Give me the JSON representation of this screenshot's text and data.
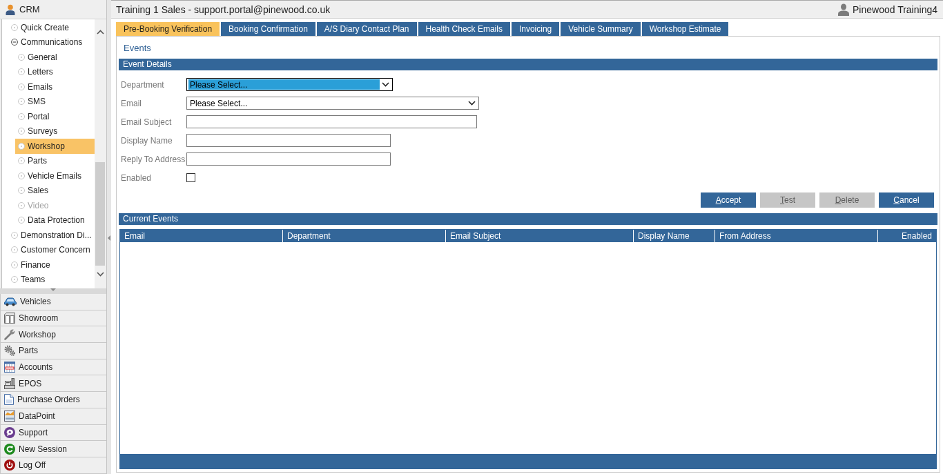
{
  "header": {
    "title": "Training 1 Sales - support.portal@pinewood.co.uk",
    "user": "Pinewood Training4"
  },
  "sidebar": {
    "title": "CRM",
    "tree": [
      {
        "label": "Quick Create",
        "selected": false,
        "disabled": false
      },
      {
        "label": "Communications",
        "selected": false,
        "disabled": false,
        "expanded": true,
        "children": [
          {
            "label": "General",
            "selected": false,
            "disabled": false
          },
          {
            "label": "Letters",
            "selected": false,
            "disabled": false
          },
          {
            "label": "Emails",
            "selected": false,
            "disabled": false
          },
          {
            "label": "SMS",
            "selected": false,
            "disabled": false
          },
          {
            "label": "Portal",
            "selected": false,
            "disabled": false
          },
          {
            "label": "Surveys",
            "selected": false,
            "disabled": false
          },
          {
            "label": "Workshop",
            "selected": true,
            "disabled": false
          },
          {
            "label": "Parts",
            "selected": false,
            "disabled": false
          },
          {
            "label": "Vehicle Emails",
            "selected": false,
            "disabled": false
          },
          {
            "label": "Sales",
            "selected": false,
            "disabled": false
          },
          {
            "label": "Video",
            "selected": false,
            "disabled": true
          },
          {
            "label": "Data Protection",
            "selected": false,
            "disabled": false
          }
        ]
      },
      {
        "label": "Demonstration Di...",
        "selected": false,
        "disabled": false
      },
      {
        "label": "Customer Concern",
        "selected": false,
        "disabled": false
      },
      {
        "label": "Finance",
        "selected": false,
        "disabled": false
      },
      {
        "label": "Teams",
        "selected": false,
        "disabled": false
      }
    ],
    "nav": [
      "Vehicles",
      "Showroom",
      "Workshop",
      "Parts",
      "Accounts",
      "EPOS",
      "Purchase Orders",
      "DataPoint",
      "Support",
      "New Session",
      "Log Off"
    ]
  },
  "tabs": [
    {
      "label": "Pre-Booking Verification",
      "selected": true
    },
    {
      "label": "Booking Confirmation",
      "selected": false
    },
    {
      "label": "A/S Diary Contact Plan",
      "selected": false
    },
    {
      "label": "Health Check Emails",
      "selected": false
    },
    {
      "label": "Invoicing",
      "selected": false
    },
    {
      "label": "Vehicle Summary",
      "selected": false
    },
    {
      "label": "Workshop Estimate",
      "selected": false
    }
  ],
  "panel": {
    "heading": "Events",
    "event_details": {
      "title": "Event Details",
      "fields": [
        {
          "kind": "select",
          "label": "Department",
          "value": "Please Select...",
          "focused": true
        },
        {
          "kind": "select",
          "label": "Email",
          "value": "Please Select...",
          "focused": false
        },
        {
          "kind": "text",
          "label": "Email Subject"
        },
        {
          "kind": "text",
          "label": "Display Name"
        },
        {
          "kind": "text",
          "label": "Reply To Address"
        },
        {
          "kind": "checkbox",
          "label": "Enabled",
          "checked": false
        }
      ],
      "buttons": [
        {
          "label": "Accept",
          "disabled": false
        },
        {
          "label": "Test",
          "disabled": true
        },
        {
          "label": "Delete",
          "disabled": true
        },
        {
          "label": "Cancel",
          "disabled": false
        }
      ]
    },
    "current_events": {
      "title": "Current Events",
      "table": {
        "columns": [
          "Email",
          "Department",
          "Email Subject",
          "Display Name",
          "From Address",
          "Enabled"
        ]
      }
    }
  }
}
